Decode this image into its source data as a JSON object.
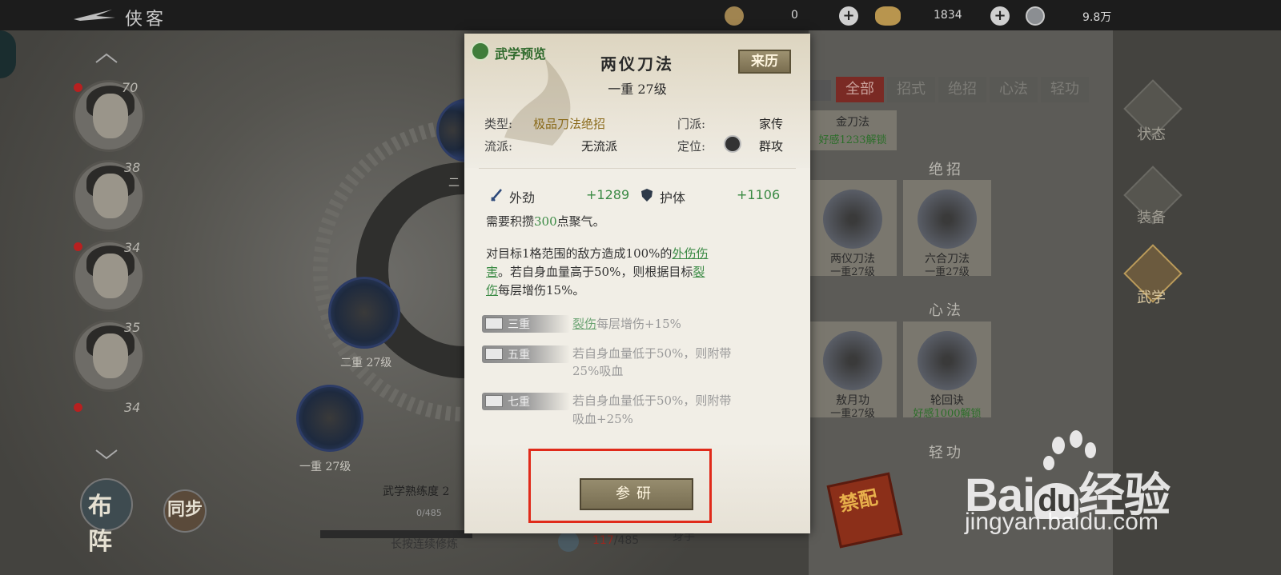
{
  "top_bar": {
    "title": "侠客",
    "resources": [
      {
        "name": "leaf-currency-icon",
        "value": "0"
      },
      {
        "name": "ingot-icon",
        "value": "1834"
      },
      {
        "name": "coin-icon",
        "value": "9.8万"
      }
    ]
  },
  "roster": {
    "levels": [
      "70",
      "38",
      "34",
      "35",
      "34"
    ],
    "badges": [
      "王",
      "侍",
      "侍",
      "侍"
    ]
  },
  "background": {
    "ring_labels": [
      "二",
      "二重 27级",
      "一重 27级"
    ],
    "mastery_label": "武学熟练度 2",
    "mastery_value": "0/485",
    "hold_hint": "长按连续修炼",
    "progress_current": "117",
    "progress_total": "/485",
    "extra_label": "身手",
    "top_card": "金刀法",
    "top_card_sub": "好感1233解锁",
    "buttons": {
      "formation": "布阵",
      "sync": "同步"
    }
  },
  "tabs": [
    "全部",
    "招式",
    "绝招",
    "心法",
    "轻功"
  ],
  "sections": {
    "ultimate": "绝招",
    "inner": "心法",
    "light": "轻功"
  },
  "cards": [
    {
      "name": "两仪刀法",
      "level": "一重27级"
    },
    {
      "name": "六合刀法",
      "level": "一重27级"
    },
    {
      "name": "敖月功",
      "level": "一重27级"
    },
    {
      "name": "轮回诀",
      "level": "好感1000解锁"
    }
  ],
  "right_nav": [
    "状态",
    "装备",
    "武学"
  ],
  "forbid_stamp": "禁配",
  "dialog": {
    "preview_label": "武学预览",
    "skill_name": "两仪刀法",
    "skill_level": "一重 27级",
    "origin_button": "来历",
    "type_label": "类型:",
    "type_value": "极品刀法绝招",
    "school_label": "门派:",
    "school_value": "家传",
    "style_label": "流派:",
    "style_value": "无流派",
    "role_label": "定位:",
    "role_value": "群攻",
    "stat1_label": "外劲",
    "stat1_value": "+1289",
    "stat2_label": "护体",
    "stat2_value": "+1106",
    "charge_pre": "需要积攒",
    "charge_num": "300",
    "charge_post": "点聚气。",
    "desc_line1_pre": "对目标1格范围的敌方造成100%的",
    "desc_link1a": "外伤伤",
    "desc_link1b": "害",
    "desc_line2_mid": "。若自身血量高于50%，则根据目标",
    "desc_link2a": "裂",
    "desc_link2b": "伤",
    "desc_line3_post": "每层增伤15%。",
    "tiers": [
      {
        "label": "三重",
        "link": "裂伤",
        "text": "每层增伤+15%"
      },
      {
        "label": "五重",
        "text1": "若自身血量低于50%，则附带",
        "text2": "25%吸血"
      },
      {
        "label": "七重",
        "text1": "若自身血量低于50%，则附带",
        "text2": "吸血+25%"
      }
    ],
    "study_button": "参研"
  },
  "watermark": {
    "brand": "Bai",
    "brand2": "du",
    "suffix": "经验",
    "url": "jingyan.baidu.com"
  },
  "colors": {
    "highlight": "#e02a1a",
    "accent_green": "#3a8a44",
    "tab_active": "#7a2a24"
  }
}
